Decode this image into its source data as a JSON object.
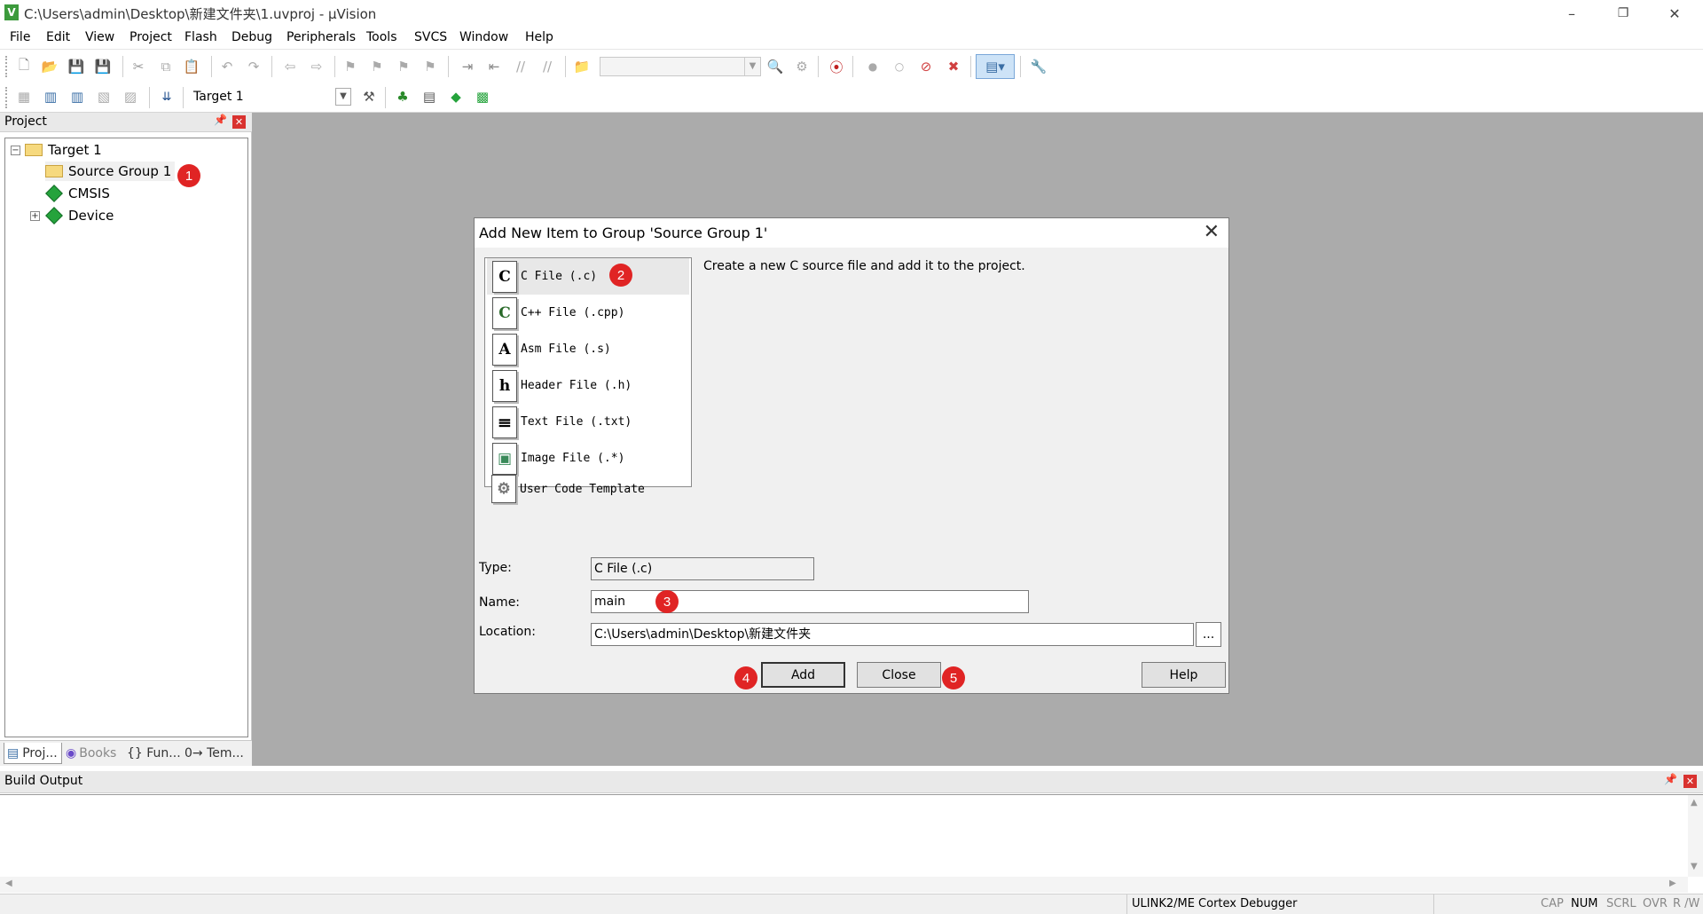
{
  "window": {
    "title": "C:\\Users\\admin\\Desktop\\新建文件夹\\1.uvproj - µVision",
    "app_icon": "V",
    "controls": {
      "minimize": "–",
      "restore": "❐",
      "close": "✕"
    }
  },
  "menu": [
    "File",
    "Edit",
    "View",
    "Project",
    "Flash",
    "Debug",
    "Peripherals",
    "Tools",
    "SVCS",
    "Window",
    "Help"
  ],
  "toolbar": {
    "target_select": "Target 1"
  },
  "project_panel": {
    "title": "Project",
    "tree": {
      "root": "Target 1",
      "group": "Source Group 1",
      "items": [
        "CMSIS",
        "Device"
      ],
      "expand_minus": "−",
      "expand_plus": "+"
    },
    "tabs": [
      "Proj...",
      "Books",
      "{} Fun...",
      "0→ Tem..."
    ]
  },
  "build_output": {
    "title": "Build Output"
  },
  "status_bar": {
    "debugger": "ULINK2/ME Cortex Debugger",
    "indicators": [
      "CAP",
      "NUM",
      "SCRL",
      "OVR",
      "R /W"
    ]
  },
  "dialog": {
    "title": "Add New Item to Group 'Source Group 1'",
    "close_glyph": "✕",
    "description": "Create a new C source file and add it to the project.",
    "file_types": [
      {
        "icon": "C",
        "label": "C File (.c)"
      },
      {
        "icon": "C",
        "label": "C++ File (.cpp)"
      },
      {
        "icon": "A",
        "label": "Asm File (.s)"
      },
      {
        "icon": "h",
        "label": "Header File (.h)"
      },
      {
        "icon": "≡",
        "label": "Text File (.txt)"
      },
      {
        "icon": "▣",
        "label": "Image File (.*)"
      },
      {
        "icon": "⚙",
        "label": "User Code Template"
      }
    ],
    "type_label": "Type:",
    "type_value": "C File (.c)",
    "name_label": "Name:",
    "name_value": "main",
    "location_label": "Location:",
    "location_value": "C:\\Users\\admin\\Desktop\\新建文件夹",
    "browse_button": "...",
    "add_button": "Add",
    "close_button": "Close",
    "help_button": "Help"
  },
  "annotations": [
    "1",
    "2",
    "3",
    "4",
    "5"
  ],
  "colors": {
    "badge": "#e02424",
    "workspace": "#ababab",
    "gem": "#25a33c",
    "folder": "#f6d97e"
  }
}
